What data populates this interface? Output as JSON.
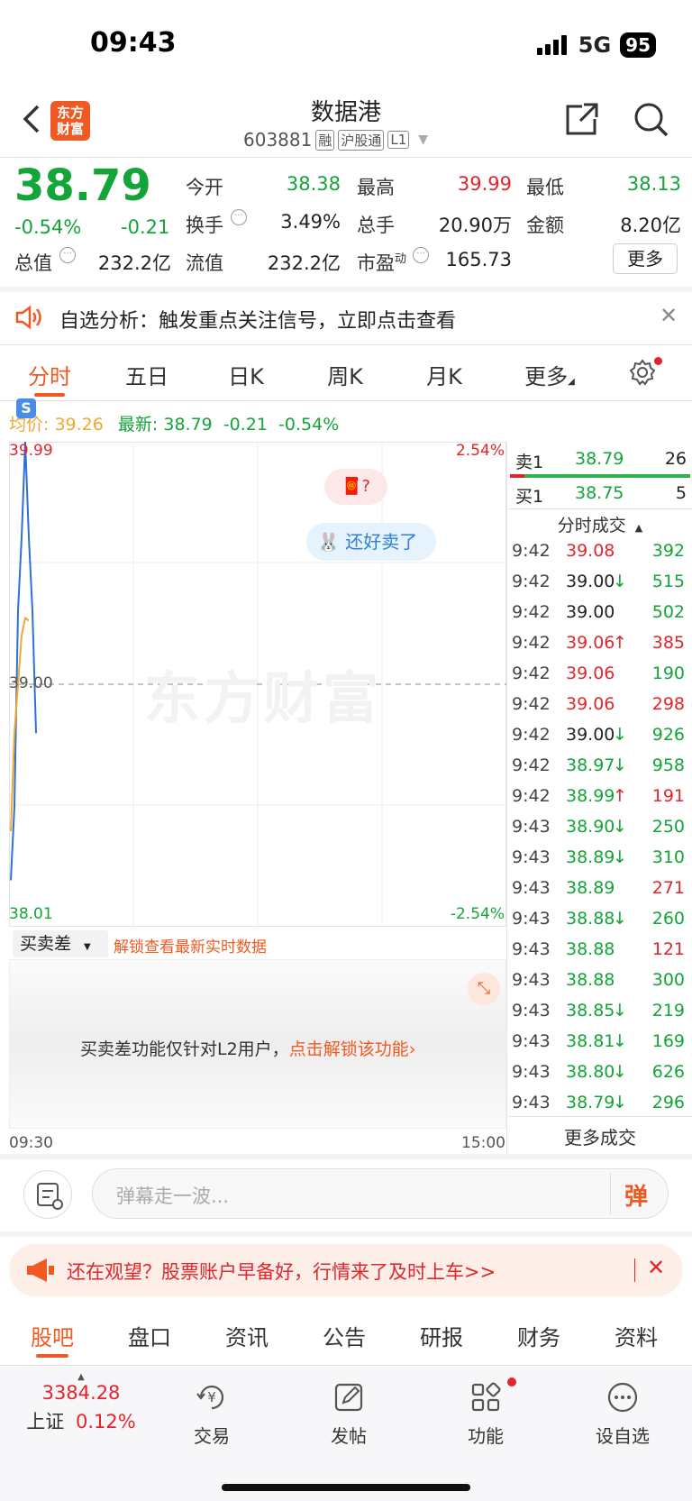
{
  "status_bar": {
    "time": "09:43",
    "network": "5G",
    "battery": "95"
  },
  "header": {
    "logo_line1": "东方",
    "logo_line2": "财富",
    "title": "数据港",
    "code": "603881",
    "badges": [
      "融",
      "沪股通",
      "L1"
    ]
  },
  "quote": {
    "price": "38.79",
    "change_pct": "-0.54%",
    "change": "-0.21",
    "rows": [
      [
        {
          "label": "今开",
          "value": "38.38",
          "color": "green"
        },
        {
          "label": "最高",
          "value": "39.99",
          "color": "red"
        },
        {
          "label": "最低",
          "value": "38.13",
          "color": "green"
        }
      ],
      [
        {
          "label": "换手",
          "value": "3.49%",
          "color": "dark"
        },
        {
          "label": "总手",
          "value": "20.90万",
          "color": "dark"
        },
        {
          "label": "金额",
          "value": "8.20亿",
          "color": "dark"
        }
      ]
    ],
    "total_value_label": "总值",
    "total_value": "232.2亿",
    "float_value_label": "流值",
    "float_value": "232.2亿",
    "pe_label": "市盈",
    "pe_sup": "动",
    "pe_value": "165.73",
    "more_label": "更多"
  },
  "banner": {
    "text": "自选分析：触发重点关注信号，立即点击查看"
  },
  "chart_tabs": [
    "分时",
    "五日",
    "日K",
    "周K",
    "月K",
    "更多"
  ],
  "chart_info": {
    "avg_label": "均价:",
    "avg_value": "39.26",
    "latest_label": "最新:",
    "latest_value": "38.79",
    "latest_change": "-0.21",
    "latest_pct": "-0.54%"
  },
  "chart_data": {
    "type": "line",
    "ylim": [
      38.01,
      39.99
    ],
    "y_labels": {
      "top": "39.99",
      "mid": "39.00",
      "bottom": "38.01"
    },
    "pct_labels": {
      "top": "2.54%",
      "bottom": "-2.54%"
    },
    "x_labels": [
      "09:30",
      "15:00"
    ],
    "series": [
      {
        "values": [
          38.2,
          38.5,
          39.3,
          39.6,
          39.99,
          39.6,
          39.3,
          38.8
        ],
        "color": "#2f6fd6"
      },
      {
        "values": [
          38.4,
          38.8,
          39.0,
          39.2,
          39.27,
          39.26
        ],
        "color": "#f0a830"
      }
    ],
    "watermark": "东方财富"
  },
  "bubbles": {
    "q": "?",
    "sell": "还好卖了"
  },
  "sub_panel": {
    "selector": "买卖差",
    "unlock_hint": "解锁查看最新实时数据",
    "message": "买卖差功能仅针对L2用户，",
    "unlock_link": "点击解锁该功能"
  },
  "order_book": [
    {
      "side": "卖1",
      "price": "38.79",
      "vol": "26"
    },
    {
      "side": "买1",
      "price": "38.75",
      "vol": "5"
    }
  ],
  "trades_header": "分时成交",
  "trades": [
    {
      "time": "9:42",
      "price": "39.08",
      "dir": "",
      "pc": "red",
      "vol": "392",
      "vc": "green"
    },
    {
      "time": "9:42",
      "price": "39.00",
      "dir": "↓",
      "pc": "dark",
      "vol": "515",
      "vc": "green"
    },
    {
      "time": "9:42",
      "price": "39.00",
      "dir": "",
      "pc": "dark",
      "vol": "502",
      "vc": "green"
    },
    {
      "time": "9:42",
      "price": "39.06",
      "dir": "↑",
      "pc": "red",
      "vol": "385",
      "vc": "red"
    },
    {
      "time": "9:42",
      "price": "39.06",
      "dir": "",
      "pc": "red",
      "vol": "190",
      "vc": "green"
    },
    {
      "time": "9:42",
      "price": "39.06",
      "dir": "",
      "pc": "red",
      "vol": "298",
      "vc": "red"
    },
    {
      "time": "9:42",
      "price": "39.00",
      "dir": "↓",
      "pc": "dark",
      "vol": "926",
      "vc": "green"
    },
    {
      "time": "9:42",
      "price": "38.97",
      "dir": "↓",
      "pc": "green",
      "vol": "958",
      "vc": "green"
    },
    {
      "time": "9:42",
      "price": "38.99",
      "dir": "↑",
      "pc": "green",
      "vol": "191",
      "vc": "red"
    },
    {
      "time": "9:43",
      "price": "38.90",
      "dir": "↓",
      "pc": "green",
      "vol": "250",
      "vc": "green"
    },
    {
      "time": "9:43",
      "price": "38.89",
      "dir": "↓",
      "pc": "green",
      "vol": "310",
      "vc": "green"
    },
    {
      "time": "9:43",
      "price": "38.89",
      "dir": "",
      "pc": "green",
      "vol": "271",
      "vc": "red"
    },
    {
      "time": "9:43",
      "price": "38.88",
      "dir": "↓",
      "pc": "green",
      "vol": "260",
      "vc": "green"
    },
    {
      "time": "9:43",
      "price": "38.88",
      "dir": "",
      "pc": "green",
      "vol": "121",
      "vc": "red"
    },
    {
      "time": "9:43",
      "price": "38.88",
      "dir": "",
      "pc": "green",
      "vol": "300",
      "vc": "green"
    },
    {
      "time": "9:43",
      "price": "38.85",
      "dir": "↓",
      "pc": "green",
      "vol": "219",
      "vc": "green"
    },
    {
      "time": "9:43",
      "price": "38.81",
      "dir": "↓",
      "pc": "green",
      "vol": "169",
      "vc": "green"
    },
    {
      "time": "9:43",
      "price": "38.80",
      "dir": "↓",
      "pc": "green",
      "vol": "626",
      "vc": "green"
    },
    {
      "time": "9:43",
      "price": "38.79",
      "dir": "↓",
      "pc": "green",
      "vol": "296",
      "vc": "green"
    }
  ],
  "more_trades": "更多成交",
  "comment": {
    "placeholder": "弹幕走一波...",
    "send_glyph": "弹"
  },
  "promo": {
    "text": "还在观望？股票账户早备好，行情来了及时上车>>"
  },
  "bottom_tabs": [
    "股吧",
    "盘口",
    "资讯",
    "公告",
    "研报",
    "财务",
    "资料"
  ],
  "bottom_nav": {
    "index_value": "3384.28",
    "index_name": "上证",
    "index_pct": "0.12%",
    "items": [
      "交易",
      "发帖",
      "功能",
      "设自选"
    ]
  },
  "colors": {
    "red": "#e0262c",
    "green": "#13a538",
    "accent": "#f05a22",
    "blue": "#2f6fd6",
    "orange": "#f0a830"
  }
}
